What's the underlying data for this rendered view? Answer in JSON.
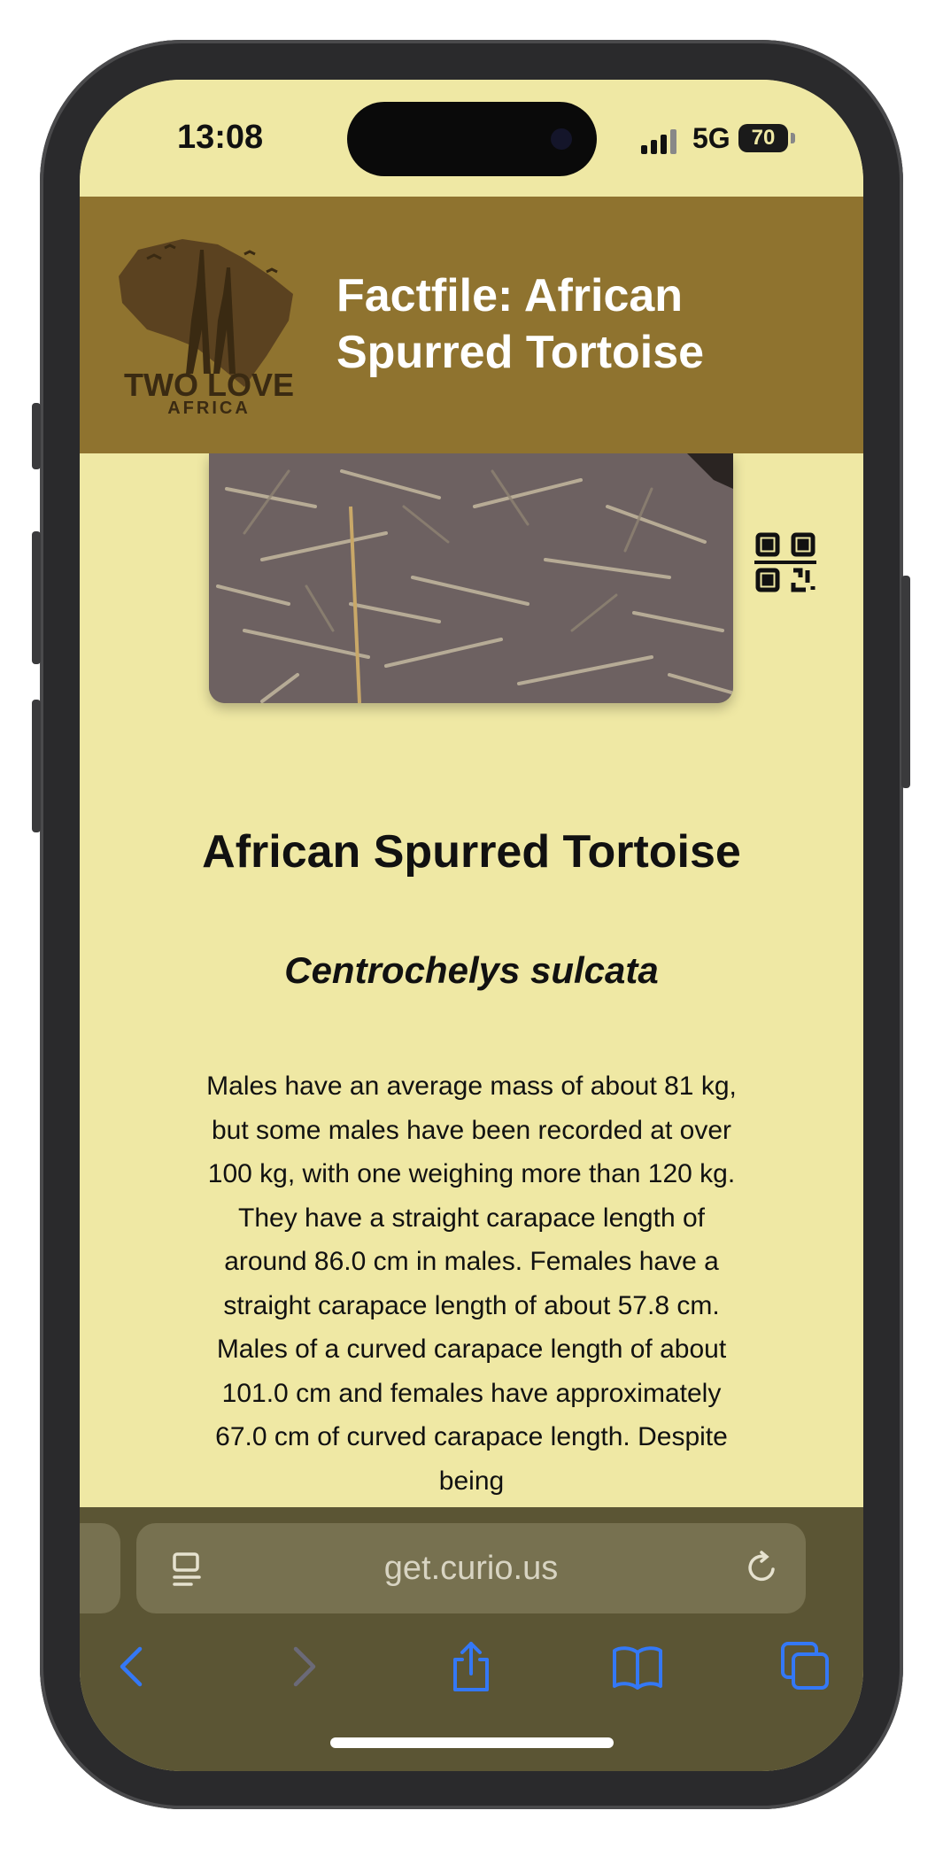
{
  "status_bar": {
    "time": "13:08",
    "network": "5G",
    "battery": "70"
  },
  "header": {
    "title": "Factfile: African Spurred Tortoise",
    "logo_text": "TWO LOVE",
    "logo_subtext": "AFRICA"
  },
  "animal": {
    "name": "African Spurred Tortoise",
    "latin_name": "Centrochelys sulcata",
    "description": "Males have an average mass of about 81 kg, but some males have been recorded at over 100 kg, with one weighing more than 120 kg. They have a straight carapace length of around 86.0 cm in males. Females have a straight carapace length of about 57.8 cm. Males of a curved carapace length of about 101.0 cm and females have approximately 67.0 cm of curved carapace length. Despite being"
  },
  "browser": {
    "url": "get.curio.us"
  },
  "icons": {
    "qr": "qr-code-icon",
    "reader": "reader-mode-icon",
    "reload": "reload-icon",
    "back": "back-icon",
    "forward": "forward-icon",
    "share": "share-icon",
    "bookmarks": "bookmarks-icon",
    "tabs": "tabs-icon"
  },
  "colors": {
    "background": "#efe8a4",
    "header": "#8f732f",
    "toolbar": "#5b5534",
    "accent": "#3478f6"
  }
}
